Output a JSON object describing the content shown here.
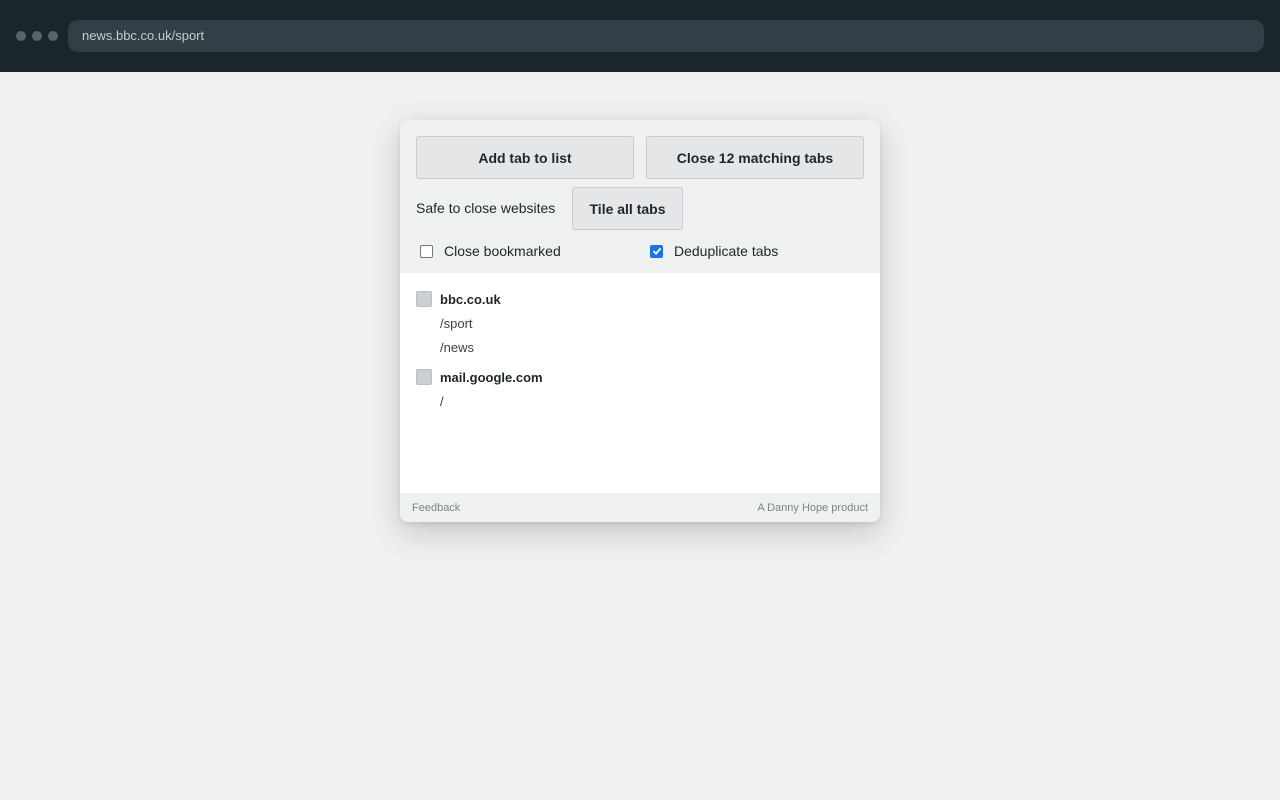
{
  "browser": {
    "url": "news.bbc.co.uk/sport"
  },
  "popup": {
    "add_tab_label": "Add tab to list",
    "close_matching_label": "Close 12 matching tabs",
    "safe_label": "Safe to close websites",
    "tile_label": "Tile all tabs",
    "options": {
      "close_bookmarked": {
        "label": "Close bookmarked",
        "checked": false
      },
      "deduplicate": {
        "label": "Deduplicate tabs",
        "checked": true
      }
    },
    "sites": [
      {
        "domain": "bbc.co.uk",
        "paths": [
          "/sport",
          "/news"
        ]
      },
      {
        "domain": "mail.google.com",
        "paths": [
          "/"
        ]
      }
    ],
    "footer": {
      "feedback": "Feedback",
      "credit": "A Danny Hope product"
    }
  }
}
